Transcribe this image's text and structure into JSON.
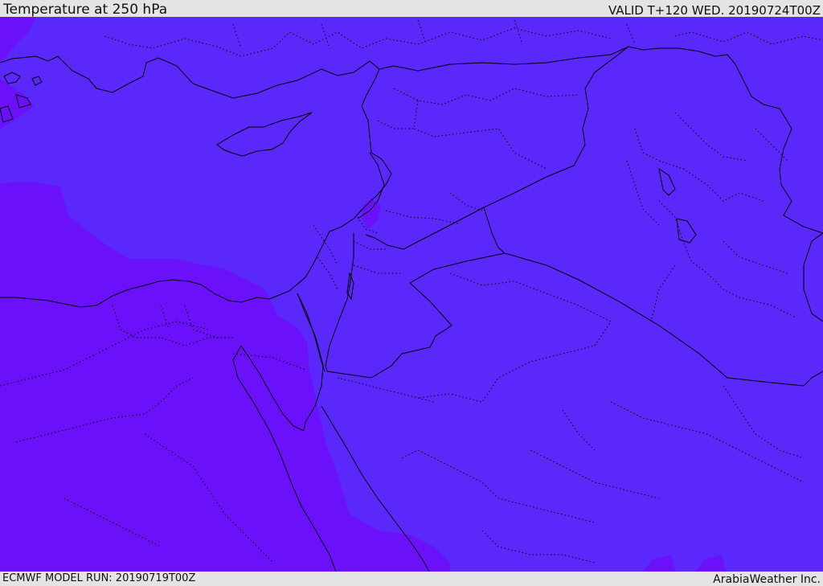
{
  "header": {
    "title": "Temperature at 250 hPa",
    "valid": "VALID T+120 WED. 20190724T00Z"
  },
  "footer": {
    "model_run": "ECMWF MODEL RUN: 20190719T00Z",
    "credit": "ArabiaWeather Inc."
  },
  "map": {
    "region": "Eastern Mediterranean and Middle East",
    "colors": {
      "base_fill": "#5a28fa",
      "cold_fill": "#6a10fa",
      "coastline": "#000000",
      "border": "#000000",
      "internal_border": "#000000"
    }
  }
}
